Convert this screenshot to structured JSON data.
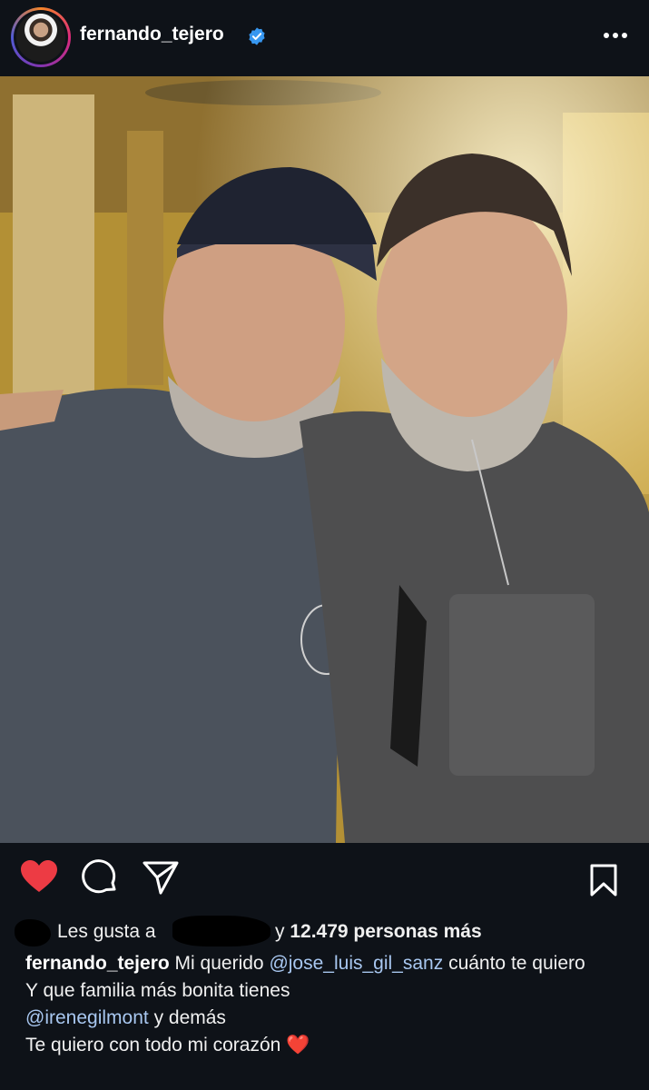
{
  "post": {
    "username": "fernando_tejero",
    "verified_icon": "verified-badge-icon",
    "more_icon": "more-options-icon"
  },
  "actions": {
    "like_icon": "heart-filled-icon",
    "comment_icon": "comment-icon",
    "share_icon": "share-icon",
    "save_icon": "bookmark-icon",
    "like_color": "#ed3b44"
  },
  "likes": {
    "prefix": "Les gusta a",
    "connector": "y",
    "count_text": "12.479 personas más"
  },
  "caption": {
    "username": "fernando_tejero",
    "line1_text": "Mi querido",
    "mention1": "@jose_luis_gil_sanz",
    "line1_end": "cuánto te quiero",
    "line2": "Y que familia más bonita tienes",
    "mention2": "@irenegilmont",
    "line3_end": "y demás",
    "line4": "Te quiero con todo mi corazón",
    "emoji": "❤️"
  },
  "colors": {
    "background": "#0e1218",
    "mention": "#a8c7f0",
    "verified": "#3797f0"
  }
}
